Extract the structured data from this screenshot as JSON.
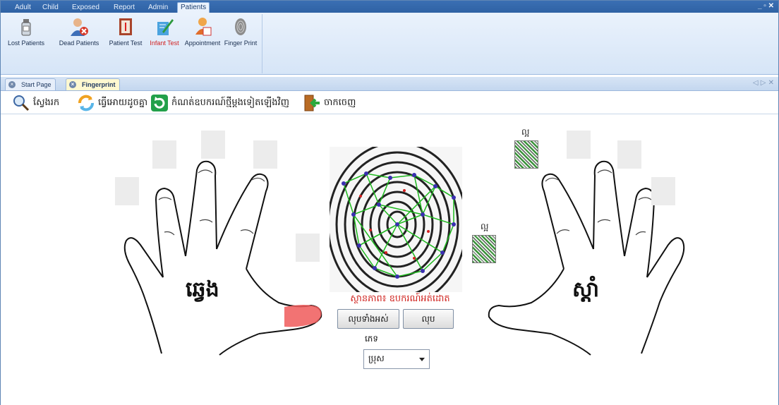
{
  "ribbon_tabs": [
    "Adult",
    "Child",
    "Exposed",
    "Report",
    "Admin",
    "Patients"
  ],
  "active_ribbon_tab": "Patients",
  "window_controls": "_ ▫ ✕",
  "ribbon_buttons": [
    {
      "label": "Lost Patients",
      "icon": "lost-patients-icon"
    },
    {
      "label": "Dead Patients",
      "icon": "dead-patients-icon"
    },
    {
      "label": "Patient Test",
      "icon": "patient-test-icon"
    },
    {
      "label": "Infant Test",
      "icon": "infant-test-icon"
    },
    {
      "label": "Appointment",
      "icon": "appointment-icon"
    },
    {
      "label": "Finger Print",
      "icon": "finger-print-icon"
    }
  ],
  "doc_tabs": [
    {
      "label": "Start Page",
      "active": false
    },
    {
      "label": "Fingerprint",
      "active": true
    }
  ],
  "doc_nav": "◁ ▷ ✕",
  "toolbar": {
    "search": "ស្វែងរក",
    "sync": "ធ្វើអោយដូចគ្នា",
    "reconnect": "កំណត់ឧបករណ៍ថ្មីម្តងទៀតឡើងវិញ",
    "exit": "ចាកចេញ"
  },
  "hands": {
    "left_label": "ឆ្វេង",
    "right_label": "ស្តាំ"
  },
  "thumbs": {
    "label_top": "ល្អ",
    "label_mid": "ល្អ"
  },
  "status": "ស្ថានភាព៖ ឧបករណ៍អត់ដោត",
  "buttons": {
    "delete_all": "លុបទាំងអស់",
    "delete": "លុប"
  },
  "sex": {
    "label": "ភេទ",
    "selected": "ប្រុស"
  },
  "colors": {
    "ribbon_blue": "#2f62a4",
    "status_red": "#d0231f",
    "fingerprint_green": "#1db81d",
    "minutia_blue": "#3a2fb0",
    "highlight_finger": "#f05a5a"
  }
}
